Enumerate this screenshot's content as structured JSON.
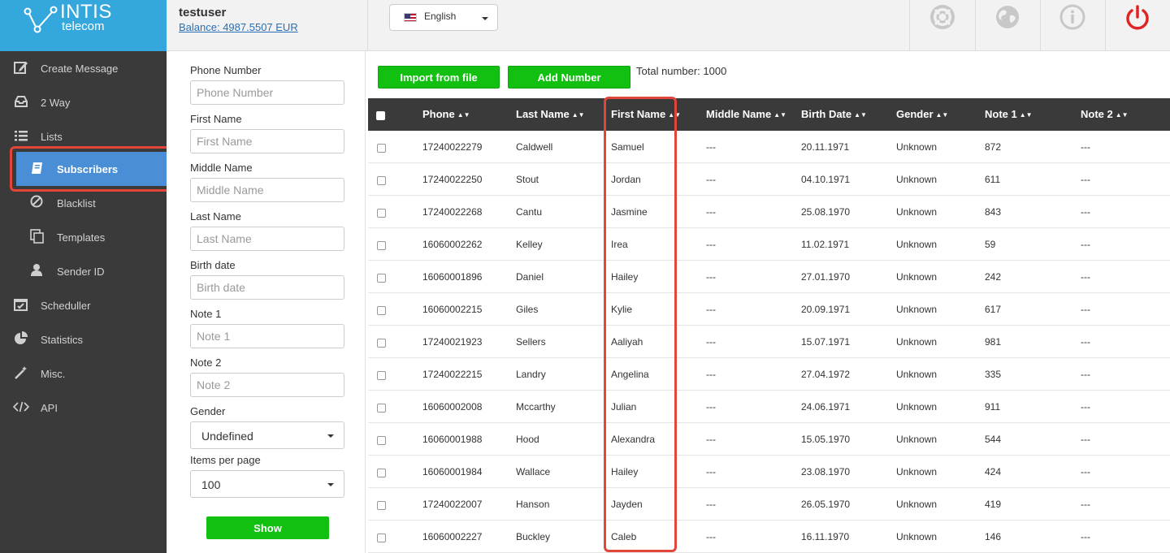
{
  "brand": {
    "name": "INTIS",
    "sub": "telecom"
  },
  "header": {
    "username": "testuser",
    "balance": "Balance: 4987.5507 EUR",
    "language": "English"
  },
  "sidebar": {
    "items": [
      {
        "label": "Create Message",
        "icon": "edit-icon"
      },
      {
        "label": "2 Way",
        "icon": "inbox-icon"
      },
      {
        "label": "Lists",
        "icon": "list-icon"
      },
      {
        "label": "Subscribers",
        "icon": "book-icon"
      },
      {
        "label": "Blacklist",
        "icon": "ban-icon"
      },
      {
        "label": "Templates",
        "icon": "copy-icon"
      },
      {
        "label": "Sender ID",
        "icon": "user-icon"
      },
      {
        "label": "Scheduller",
        "icon": "calendar-icon"
      },
      {
        "label": "Statistics",
        "icon": "pie-chart-icon"
      },
      {
        "label": "Misc.",
        "icon": "magic-wand-icon"
      },
      {
        "label": "API",
        "icon": "code-icon"
      }
    ]
  },
  "filter": {
    "phone_label": "Phone Number",
    "phone_placeholder": "Phone Number",
    "first_label": "First Name",
    "first_placeholder": "First Name",
    "middle_label": "Middle Name",
    "middle_placeholder": "Middle Name",
    "last_label": "Last Name",
    "last_placeholder": "Last Name",
    "birth_label": "Birth date",
    "birth_placeholder": "Birth date",
    "note1_label": "Note 1",
    "note1_placeholder": "Note 1",
    "note2_label": "Note 2",
    "note2_placeholder": "Note 2",
    "gender_label": "Gender",
    "gender_value": "Undefined",
    "items_label": "Items per page",
    "items_value": "100",
    "show_label": "Show"
  },
  "toolbar": {
    "import_label": "Import from file",
    "add_label": "Add Number",
    "total": "Total number: 1000"
  },
  "table": {
    "headers": {
      "phone": "Phone",
      "last": "Last Name",
      "first": "First Name",
      "middle": "Middle Name",
      "birth": "Birth Date",
      "gender": "Gender",
      "note1": "Note 1",
      "note2": "Note 2"
    },
    "rows": [
      {
        "phone": "17240022279",
        "last": "Caldwell",
        "first": "Samuel",
        "middle": "---",
        "birth": "20.11.1971",
        "gender": "Unknown",
        "note1": "872",
        "note2": "---"
      },
      {
        "phone": "17240022250",
        "last": "Stout",
        "first": "Jordan",
        "middle": "---",
        "birth": "04.10.1971",
        "gender": "Unknown",
        "note1": "611",
        "note2": "---"
      },
      {
        "phone": "17240022268",
        "last": "Cantu",
        "first": "Jasmine",
        "middle": "---",
        "birth": "25.08.1970",
        "gender": "Unknown",
        "note1": "843",
        "note2": "---"
      },
      {
        "phone": "16060002262",
        "last": "Kelley",
        "first": "Irea",
        "middle": "---",
        "birth": "11.02.1971",
        "gender": "Unknown",
        "note1": "59",
        "note2": "---"
      },
      {
        "phone": "16060001896",
        "last": "Daniel",
        "first": "Hailey",
        "middle": "---",
        "birth": "27.01.1970",
        "gender": "Unknown",
        "note1": "242",
        "note2": "---"
      },
      {
        "phone": "16060002215",
        "last": "Giles",
        "first": "Kylie",
        "middle": "---",
        "birth": "20.09.1971",
        "gender": "Unknown",
        "note1": "617",
        "note2": "---"
      },
      {
        "phone": "17240021923",
        "last": "Sellers",
        "first": "Aaliyah",
        "middle": "---",
        "birth": "15.07.1971",
        "gender": "Unknown",
        "note1": "981",
        "note2": "---"
      },
      {
        "phone": "17240022215",
        "last": "Landry",
        "first": "Angelina",
        "middle": "---",
        "birth": "27.04.1972",
        "gender": "Unknown",
        "note1": "335",
        "note2": "---"
      },
      {
        "phone": "16060002008",
        "last": "Mccarthy",
        "first": "Julian",
        "middle": "---",
        "birth": "24.06.1971",
        "gender": "Unknown",
        "note1": "911",
        "note2": "---"
      },
      {
        "phone": "16060001988",
        "last": "Hood",
        "first": "Alexandra",
        "middle": "---",
        "birth": "15.05.1970",
        "gender": "Unknown",
        "note1": "544",
        "note2": "---"
      },
      {
        "phone": "16060001984",
        "last": "Wallace",
        "first": "Hailey",
        "middle": "---",
        "birth": "23.08.1970",
        "gender": "Unknown",
        "note1": "424",
        "note2": "---"
      },
      {
        "phone": "17240022007",
        "last": "Hanson",
        "first": "Jayden",
        "middle": "---",
        "birth": "26.05.1970",
        "gender": "Unknown",
        "note1": "419",
        "note2": "---"
      },
      {
        "phone": "16060002227",
        "last": "Buckley",
        "first": "Caleb",
        "middle": "---",
        "birth": "16.11.1970",
        "gender": "Unknown",
        "note1": "146",
        "note2": "---"
      }
    ]
  },
  "colors": {
    "brand": "#34a8dd",
    "sidebar": "#3a3a3a",
    "active": "#4a8fd5",
    "green": "#11c010",
    "highlight": "#e2453a",
    "power": "#e02424"
  }
}
